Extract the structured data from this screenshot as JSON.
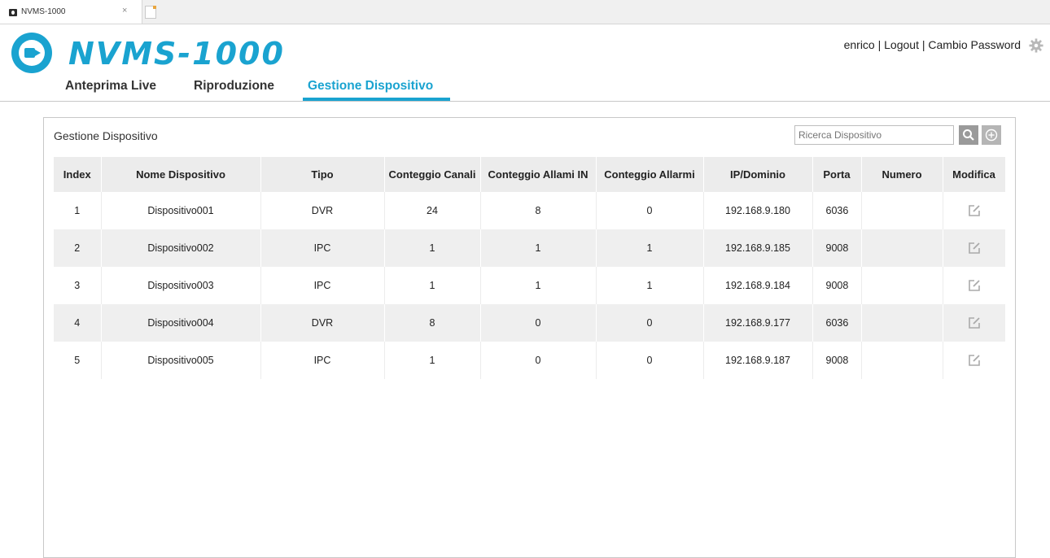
{
  "browser": {
    "tab_title": "NVMS-1000",
    "tab_close": "×"
  },
  "header": {
    "logo_text": "NVMS-1000",
    "user": "enrico",
    "logout": "Logout",
    "change_password": "Cambio Password",
    "separator": "|"
  },
  "nav": {
    "items": [
      {
        "label": "Anteprima Live",
        "active": false
      },
      {
        "label": "Riproduzione",
        "active": false
      },
      {
        "label": "Gestione Dispositivo",
        "active": true
      }
    ]
  },
  "panel": {
    "title": "Gestione Dispositivo",
    "search_placeholder": "Ricerca Dispositivo",
    "columns": [
      "Index",
      "Nome Dispositivo",
      "Tipo",
      "Conteggio Canali",
      "Conteggio Allami IN",
      "Conteggio Allarmi",
      "IP/Dominio",
      "Porta",
      "Numero",
      "Modifica"
    ],
    "rows": [
      [
        "1",
        "Dispositivo001",
        "DVR",
        "24",
        "8",
        "0",
        "192.168.9.180",
        "6036",
        ""
      ],
      [
        "2",
        "Dispositivo002",
        "IPC",
        "1",
        "1",
        "1",
        "192.168.9.185",
        "9008",
        ""
      ],
      [
        "3",
        "Dispositivo003",
        "IPC",
        "1",
        "1",
        "1",
        "192.168.9.184",
        "9008",
        ""
      ],
      [
        "4",
        "Dispositivo004",
        "DVR",
        "8",
        "0",
        "0",
        "192.168.9.177",
        "6036",
        ""
      ],
      [
        "5",
        "Dispositivo005",
        "IPC",
        "1",
        "0",
        "0",
        "192.168.9.187",
        "9008",
        ""
      ]
    ]
  },
  "colors": {
    "accent": "#1aa3d0",
    "header_bg": "#ececec",
    "stripe_bg": "#efefef"
  }
}
